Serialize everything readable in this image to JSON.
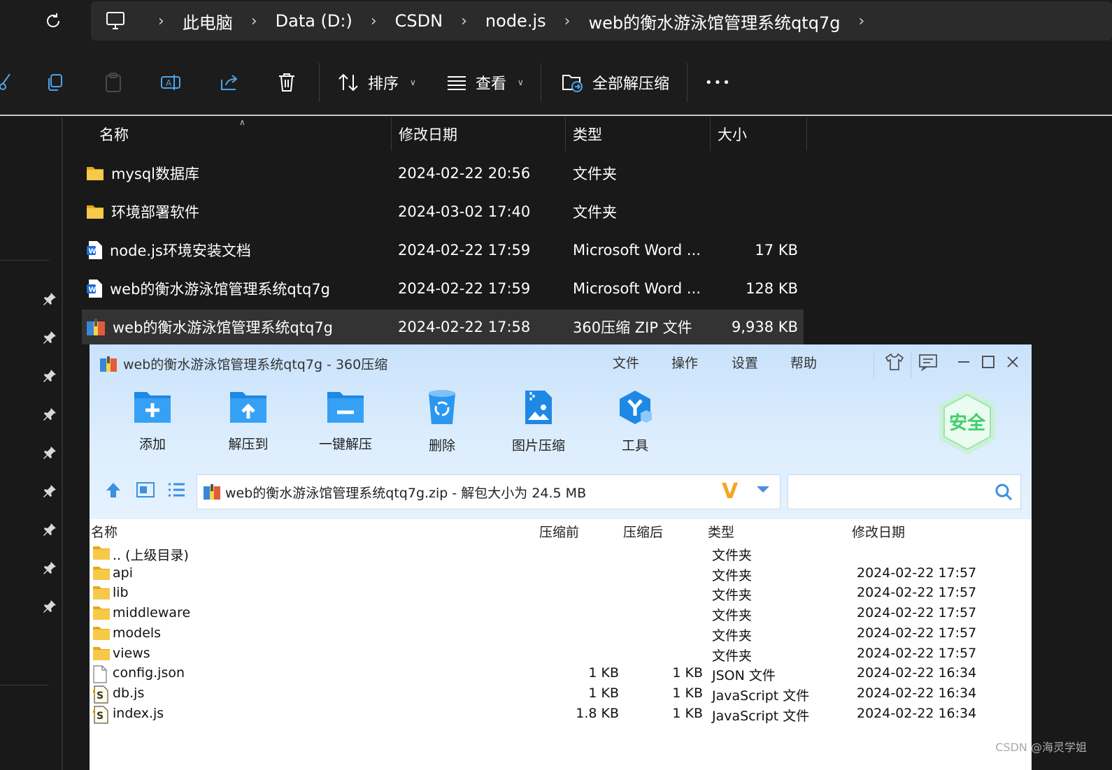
{
  "breadcrumb": [
    "此电脑",
    "Data (D:)",
    "CSDN",
    "node.js",
    "web的衡水游泳馆管理系统qtq7g"
  ],
  "toolbar": {
    "sort_label": "排序",
    "view_label": "查看",
    "extract_all_label": "全部解压缩",
    "more_label": "•••"
  },
  "explorer": {
    "columns": {
      "name": "名称",
      "modified": "修改日期",
      "type": "类型",
      "size": "大小"
    },
    "rows": [
      {
        "name": "mysql数据库",
        "modified": "2024-02-22 20:56",
        "type": "文件夹",
        "size": "",
        "icon": "folder-icon"
      },
      {
        "name": "环境部署软件",
        "modified": "2024-03-02 17:40",
        "type": "文件夹",
        "size": "",
        "icon": "folder-icon"
      },
      {
        "name": "node.js环境安装文档",
        "modified": "2024-02-22 17:59",
        "type": "Microsoft Word ...",
        "size": "17 KB",
        "icon": "word-doc-icon"
      },
      {
        "name": "web的衡水游泳馆管理系统qtq7g",
        "modified": "2024-02-22 17:59",
        "type": "Microsoft Word ...",
        "size": "128 KB",
        "icon": "word-doc-icon"
      },
      {
        "name": "web的衡水游泳馆管理系统qtq7g",
        "modified": "2024-02-22 17:58",
        "type": "360压缩 ZIP 文件",
        "size": "9,938 KB",
        "icon": "zip-archive-icon",
        "selected": true
      }
    ]
  },
  "zip_window": {
    "title": "web的衡水游泳馆管理系统qtq7g - 360压缩",
    "menu": [
      "文件",
      "操作",
      "设置",
      "帮助"
    ],
    "tools": [
      "添加",
      "解压到",
      "一键解压",
      "删除",
      "图片压缩",
      "工具"
    ],
    "safe_badge": "安全",
    "path_text": "web的衡水游泳馆管理系统qtq7g.zip - 解包大小为 24.5 MB",
    "columns": {
      "name": "名称",
      "before": "压缩前",
      "after": "压缩后",
      "type": "类型",
      "modified": "修改日期"
    },
    "rows": [
      {
        "name": ".. (上级目录)",
        "before": "",
        "after": "",
        "type": "文件夹",
        "modified": "",
        "icon": "folder-icon"
      },
      {
        "name": "api",
        "before": "",
        "after": "",
        "type": "文件夹",
        "modified": "2024-02-22 17:57",
        "icon": "folder-icon"
      },
      {
        "name": "lib",
        "before": "",
        "after": "",
        "type": "文件夹",
        "modified": "2024-02-22 17:57",
        "icon": "folder-icon"
      },
      {
        "name": "middleware",
        "before": "",
        "after": "",
        "type": "文件夹",
        "modified": "2024-02-22 17:57",
        "icon": "folder-icon"
      },
      {
        "name": "models",
        "before": "",
        "after": "",
        "type": "文件夹",
        "modified": "2024-02-22 17:57",
        "icon": "folder-icon"
      },
      {
        "name": "views",
        "before": "",
        "after": "",
        "type": "文件夹",
        "modified": "2024-02-22 17:57",
        "icon": "folder-icon"
      },
      {
        "name": "config.json",
        "before": "1 KB",
        "after": "1 KB",
        "type": "JSON 文件",
        "modified": "2024-02-22 16:34",
        "icon": "json-file-icon"
      },
      {
        "name": "db.js",
        "before": "1 KB",
        "after": "1 KB",
        "type": "JavaScript 文件",
        "modified": "2024-02-22 16:34",
        "icon": "js-file-icon"
      },
      {
        "name": "index.js",
        "before": "1.8 KB",
        "after": "1 KB",
        "type": "JavaScript 文件",
        "modified": "2024-02-22 16:34",
        "icon": "js-file-icon"
      }
    ]
  },
  "watermark": "CSDN @海灵学姐",
  "colors": {
    "explorer_bg": "#191919",
    "selection": "#333333",
    "zip_header": "#c9e2fb",
    "safe_green": "#3fcf6a",
    "folder_yellow": "#f7c948"
  }
}
